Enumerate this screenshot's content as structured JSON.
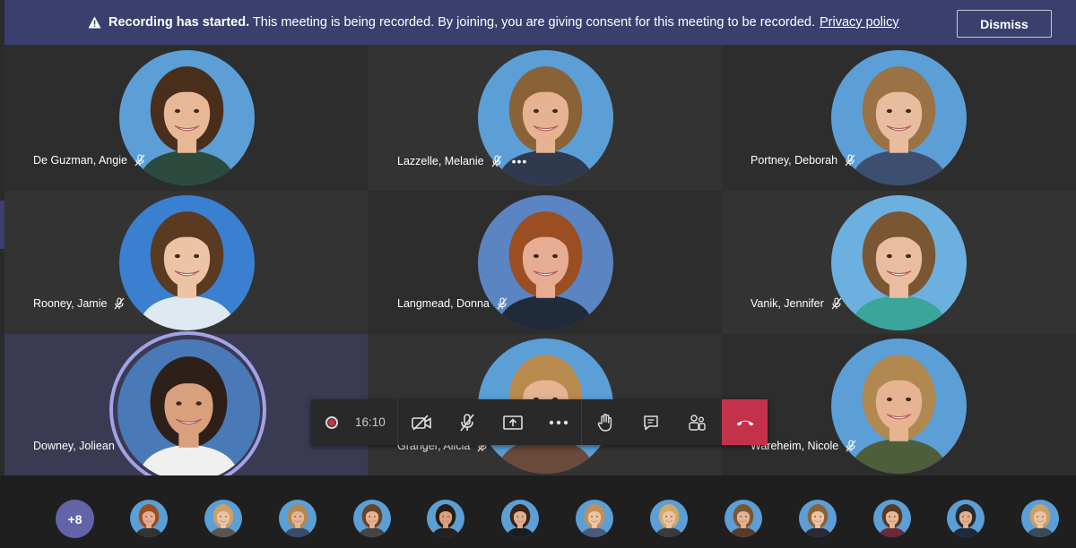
{
  "banner": {
    "title": "Recording has started.",
    "message": "This meeting is being recorded. By joining, you are giving consent for this meeting to be recorded.",
    "link": "Privacy policy",
    "dismiss": "Dismiss"
  },
  "participants": [
    {
      "name": "De Guzman, Angie",
      "muted": true
    },
    {
      "name": "Lazzelle, Melanie",
      "muted": true,
      "more": "•••"
    },
    {
      "name": "Portney, Deborah",
      "muted": true
    },
    {
      "name": "Rooney, Jamie",
      "muted": true
    },
    {
      "name": "Langmead, Donna",
      "muted": true
    },
    {
      "name": "Vanik, Jennifer",
      "muted": true
    },
    {
      "name": "Downey, Joliean",
      "muted": false,
      "speaking": true
    },
    {
      "name": "Granger, Alicia",
      "muted": true
    },
    {
      "name": "Wareheim, Nicole",
      "muted": true
    }
  ],
  "controls": {
    "timer": "16:10",
    "icons": [
      "record-icon",
      "camera-off-icon",
      "mic-off-icon",
      "share-screen-icon",
      "more-icon",
      "raise-hand-icon",
      "chat-icon",
      "participants-icon",
      "hang-up-icon"
    ]
  },
  "overflow": {
    "label": "+8",
    "thumbnail_count": 13
  },
  "colors": {
    "banner": "#3b3f6e",
    "accent": "#6264a7",
    "speaking_ring": "#a3a2e6",
    "hangup": "#c4314b",
    "tile_dark": "#2d2d2d",
    "tile_light": "#333333"
  }
}
